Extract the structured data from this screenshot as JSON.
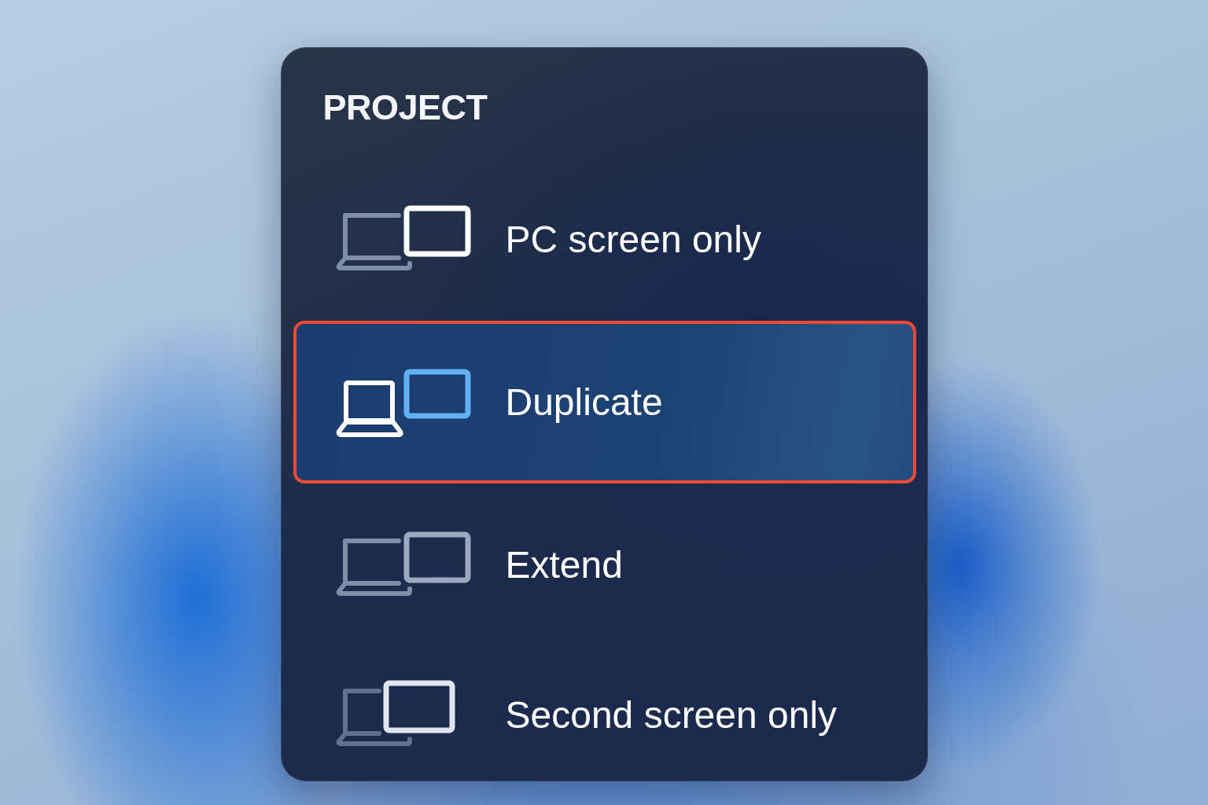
{
  "flyout": {
    "title": "PROJECT",
    "options": [
      {
        "label": "PC screen only",
        "kind": "pc_only",
        "selected": false
      },
      {
        "label": "Duplicate",
        "kind": "duplicate",
        "selected": true
      },
      {
        "label": "Extend",
        "kind": "extend",
        "selected": false
      },
      {
        "label": "Second screen only",
        "kind": "second_only",
        "selected": false
      }
    ]
  }
}
